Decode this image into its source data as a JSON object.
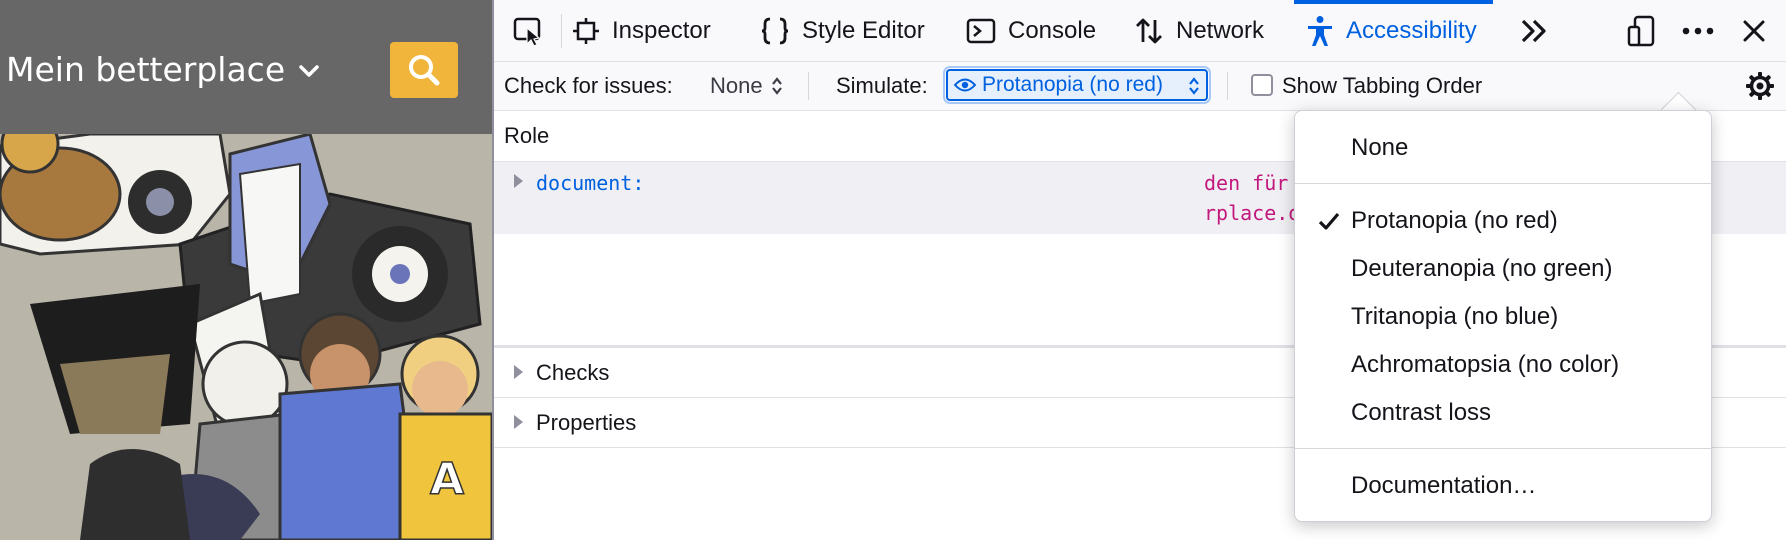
{
  "site": {
    "title": "Mein betterplace"
  },
  "devtools": {
    "tabs": [
      {
        "label": "Inspector",
        "icon": "inspector-icon"
      },
      {
        "label": "Style Editor",
        "icon": "style-editor-icon"
      },
      {
        "label": "Console",
        "icon": "console-icon"
      },
      {
        "label": "Network",
        "icon": "network-icon"
      },
      {
        "label": "Accessibility",
        "icon": "accessibility-icon",
        "active": true
      }
    ],
    "toolbar": {
      "check_label": "Check for issues:",
      "check_value": "None",
      "simulate_label": "Simulate:",
      "simulate_value": "Protanopia (no red)",
      "tabbing_label": "Show Tabbing Order",
      "tabbing_checked": false
    },
    "tree": {
      "column_role": "Role",
      "node": {
        "role": "document:",
        "name_line1": "den für Projekte & O…ionen –",
        "name_line2": "rplace.org\""
      }
    },
    "sidebar": {
      "checks": "Checks",
      "properties": "Properties"
    }
  },
  "simulate_menu": {
    "items": [
      {
        "label": "None",
        "checked": false
      },
      {
        "label": "Protanopia (no red)",
        "checked": true
      },
      {
        "label": "Deuteranopia (no green)",
        "checked": false
      },
      {
        "label": "Tritanopia (no blue)",
        "checked": false
      },
      {
        "label": "Achromatopsia (no color)",
        "checked": false
      },
      {
        "label": "Contrast loss",
        "checked": false
      },
      {
        "label": "Documentation…",
        "checked": false
      }
    ]
  },
  "colors": {
    "accent": "#0061e0",
    "site_header": "#676767",
    "search_button": "#f0b53a",
    "tree_name": "#c2187d"
  }
}
